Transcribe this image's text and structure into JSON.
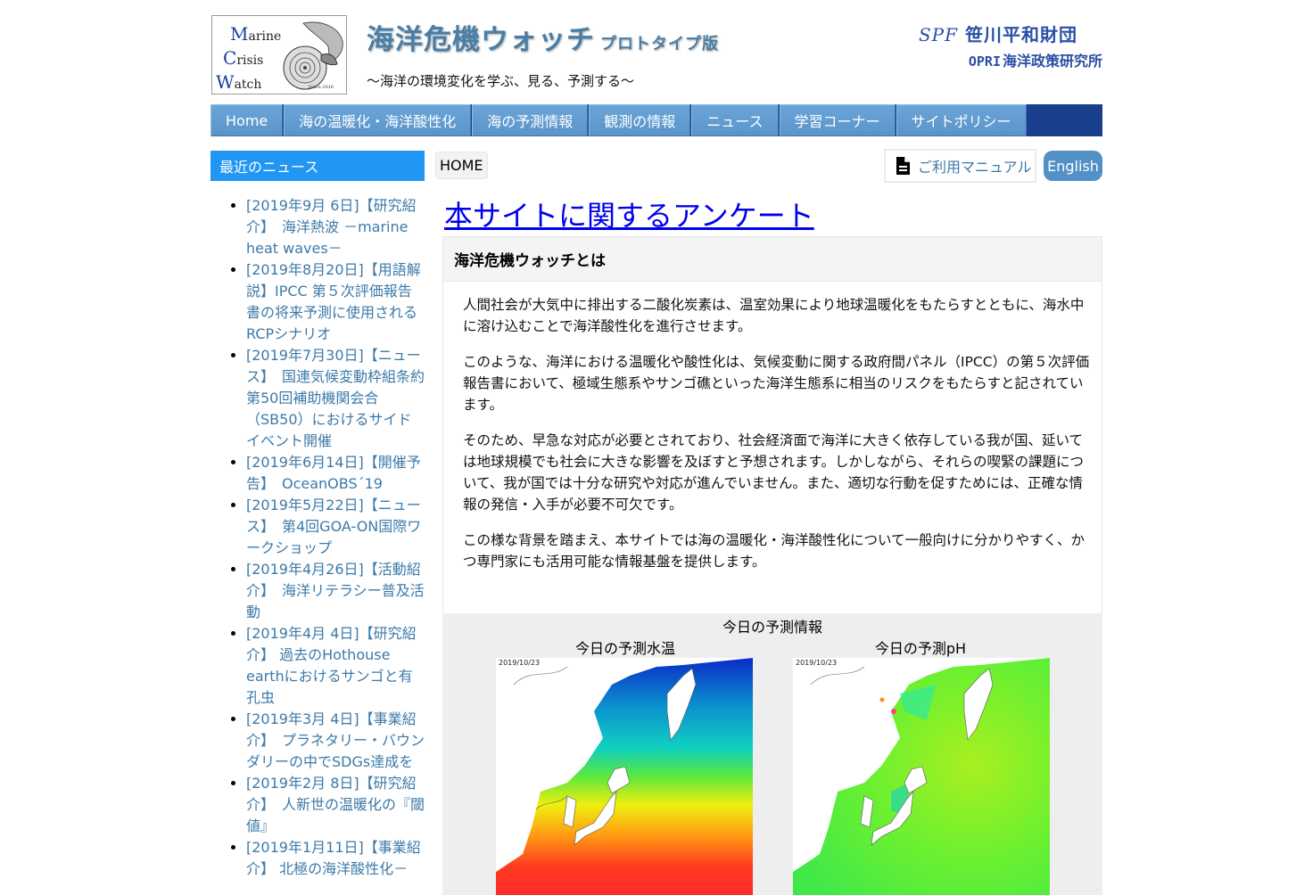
{
  "header": {
    "logo": {
      "lines": [
        {
          "cap": "M",
          "rest": "arine"
        },
        {
          "cap": "C",
          "rest": "risis"
        },
        {
          "cap": "W",
          "rest": "atch"
        }
      ],
      "since": "Since 2016"
    },
    "title": "海洋危機ウォッチ",
    "title_sub": "プロトタイプ版",
    "tagline": "～海洋の環境変化を学ぶ、見る、予測する～",
    "org1_abbr": "SPF",
    "org1_name": "笹川平和財団",
    "org2_abbr": "OPRI",
    "org2_name": "海洋政策研究所"
  },
  "nav": {
    "items": [
      {
        "label": "Home"
      },
      {
        "label": "海の温暖化・海洋酸性化"
      },
      {
        "label": "海の予測情報"
      },
      {
        "label": "観測の情報"
      },
      {
        "label": "ニュース"
      },
      {
        "label": "学習コーナー"
      },
      {
        "label": "サイトポリシー"
      }
    ]
  },
  "sidebar": {
    "title": "最近のニュース",
    "news": [
      "[2019年9月 6日]【研究紹介】　海洋熱波 －marine heat waves－",
      "[2019年8月20日]【用語解説】IPCC 第５次評価報告書の将来予測に使用されるRCPシナリオ",
      "[2019年7月30日]【ニュース】　国連気候変動枠組条約第50回補助機関会合（SB50）におけるサイドイベント開催",
      "[2019年6月14日]【開催予告】　OceanOBS´19",
      "[2019年5月22日]【ニュース】　第4回GOA-ON国際ワークショップ",
      "[2019年4月26日]【活動紹介】　海洋リテラシー普及活動",
      "[2019年4月 4日]【研究紹介】 過去のHothouse earthにおけるサンゴと有孔虫",
      "[2019年3月 4日]【事業紹介】　プラネタリー・バウンダリーの中でSDGs達成を",
      "[2019年2月 8日]【研究紹介】　人新世の温暖化の『閾値』",
      "[2019年1月11日]【事業紹介】 北極の海洋酸性化－"
    ]
  },
  "main": {
    "breadcrumb": "HOME",
    "manual_label": "ご利用マニュアル",
    "english_label": "English",
    "survey_link": "本サイトに関するアンケート",
    "about": {
      "title": "海洋危機ウォッチとは",
      "paragraphs": [
        "人間社会が大気中に排出する二酸化炭素は、温室効果により地球温暖化をもたらすとともに、海水中に溶け込むことで海洋酸性化を進行させます。",
        "このような、海洋における温暖化や酸性化は、気候変動に関する政府間パネル（IPCC）の第５次評価報告書において、極域生態系やサンゴ礁といった海洋生態系に相当のリスクをもたらすと記されています。",
        "そのため、早急な対応が必要とされており、社会経済面で海洋に大きく依存している我が国、延いては地球規模でも社会に大きな影響を及ぼすと予想されます。しかしながら、それらの喫緊の課題について、我が国では十分な研究や対応が進んでいません。また、適切な行動を促すためには、正確な情報の発信・入手が必要不可欠です。",
        "この様な背景を踏まえ、本サイトでは海の温暖化・海洋酸性化について一般向けに分かりやすく、かつ専門家にも活用可能な情報基盤を提供します。"
      ]
    },
    "forecast": {
      "title": "今日の予測情報",
      "temp_label": "今日の予測水温",
      "ph_label": "今日の予測pH",
      "date": "2019/10/23"
    }
  }
}
